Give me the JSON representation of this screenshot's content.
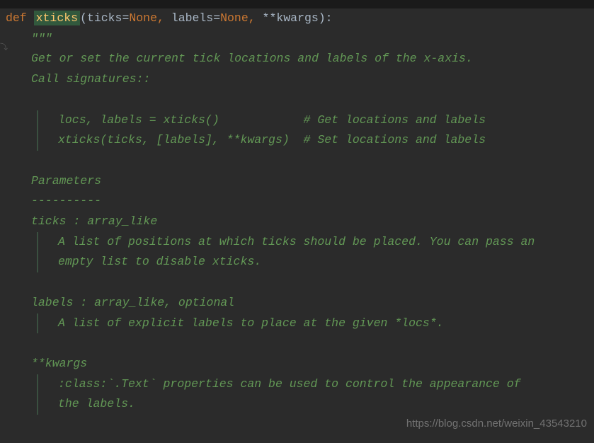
{
  "code": {
    "kw_def": "def",
    "fn_name": "xticks",
    "open_paren": "(",
    "p1": "ticks",
    "eq": "=",
    "none": "None",
    "comma": ",",
    "sp": " ",
    "p2": "labels",
    "stars": "**",
    "p3": "kwargs",
    "close": "):"
  },
  "doc": {
    "triple": "\"\"\"",
    "l1": "Get or set the current tick locations and labels of the x-axis.",
    "blank": "",
    "l2": "Call signatures::",
    "l3": "locs, labels = xticks()            # Get locations and labels",
    "l4": "xticks(ticks, [labels], **kwargs)  # Set locations and labels",
    "l5": "Parameters",
    "l6": "----------",
    "l7": "ticks : array_like",
    "l8": "A list of positions at which ticks should be placed. You can pass an",
    "l9": "empty list to disable xticks.",
    "l10": "labels : array_like, optional",
    "l11": "A list of explicit labels to place at the given *locs*.",
    "l12": "**kwargs",
    "l13": ":class:`.Text` properties can be used to control the appearance of",
    "l14": "the labels."
  },
  "watermark": "https://blog.csdn.net/weixin_43543210"
}
